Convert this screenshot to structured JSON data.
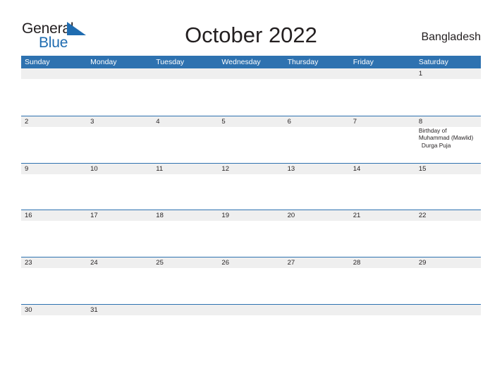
{
  "brand": {
    "name_part1": "General",
    "name_part2": "Blue",
    "accent_color": "#1f6cb0"
  },
  "header": {
    "title": "October 2022",
    "country": "Bangladesh"
  },
  "theme": {
    "header_blue": "#2e72b0",
    "band_gray": "#efefef",
    "text_dark": "#231f20"
  },
  "calendar": {
    "weekdays": [
      "Sunday",
      "Monday",
      "Tuesday",
      "Wednesday",
      "Thursday",
      "Friday",
      "Saturday"
    ],
    "weeks": [
      {
        "days": [
          {
            "num": "",
            "events": []
          },
          {
            "num": "",
            "events": []
          },
          {
            "num": "",
            "events": []
          },
          {
            "num": "",
            "events": []
          },
          {
            "num": "",
            "events": []
          },
          {
            "num": "",
            "events": []
          },
          {
            "num": "1",
            "events": []
          }
        ]
      },
      {
        "days": [
          {
            "num": "2",
            "events": []
          },
          {
            "num": "3",
            "events": []
          },
          {
            "num": "4",
            "events": []
          },
          {
            "num": "5",
            "events": []
          },
          {
            "num": "6",
            "events": []
          },
          {
            "num": "7",
            "events": []
          },
          {
            "num": "8",
            "events": [
              {
                "label": "Birthday of Muhammad (Mawlid)",
                "indent": false
              },
              {
                "label": "Durga Puja",
                "indent": true
              }
            ]
          }
        ]
      },
      {
        "days": [
          {
            "num": "9",
            "events": []
          },
          {
            "num": "10",
            "events": []
          },
          {
            "num": "11",
            "events": []
          },
          {
            "num": "12",
            "events": []
          },
          {
            "num": "13",
            "events": []
          },
          {
            "num": "14",
            "events": []
          },
          {
            "num": "15",
            "events": []
          }
        ]
      },
      {
        "days": [
          {
            "num": "16",
            "events": []
          },
          {
            "num": "17",
            "events": []
          },
          {
            "num": "18",
            "events": []
          },
          {
            "num": "19",
            "events": []
          },
          {
            "num": "20",
            "events": []
          },
          {
            "num": "21",
            "events": []
          },
          {
            "num": "22",
            "events": []
          }
        ]
      },
      {
        "days": [
          {
            "num": "23",
            "events": []
          },
          {
            "num": "24",
            "events": []
          },
          {
            "num": "25",
            "events": []
          },
          {
            "num": "26",
            "events": []
          },
          {
            "num": "27",
            "events": []
          },
          {
            "num": "28",
            "events": []
          },
          {
            "num": "29",
            "events": []
          }
        ]
      },
      {
        "days": [
          {
            "num": "30",
            "events": []
          },
          {
            "num": "31",
            "events": []
          },
          {
            "num": "",
            "events": []
          },
          {
            "num": "",
            "events": []
          },
          {
            "num": "",
            "events": []
          },
          {
            "num": "",
            "events": []
          },
          {
            "num": "",
            "events": []
          }
        ]
      }
    ]
  }
}
